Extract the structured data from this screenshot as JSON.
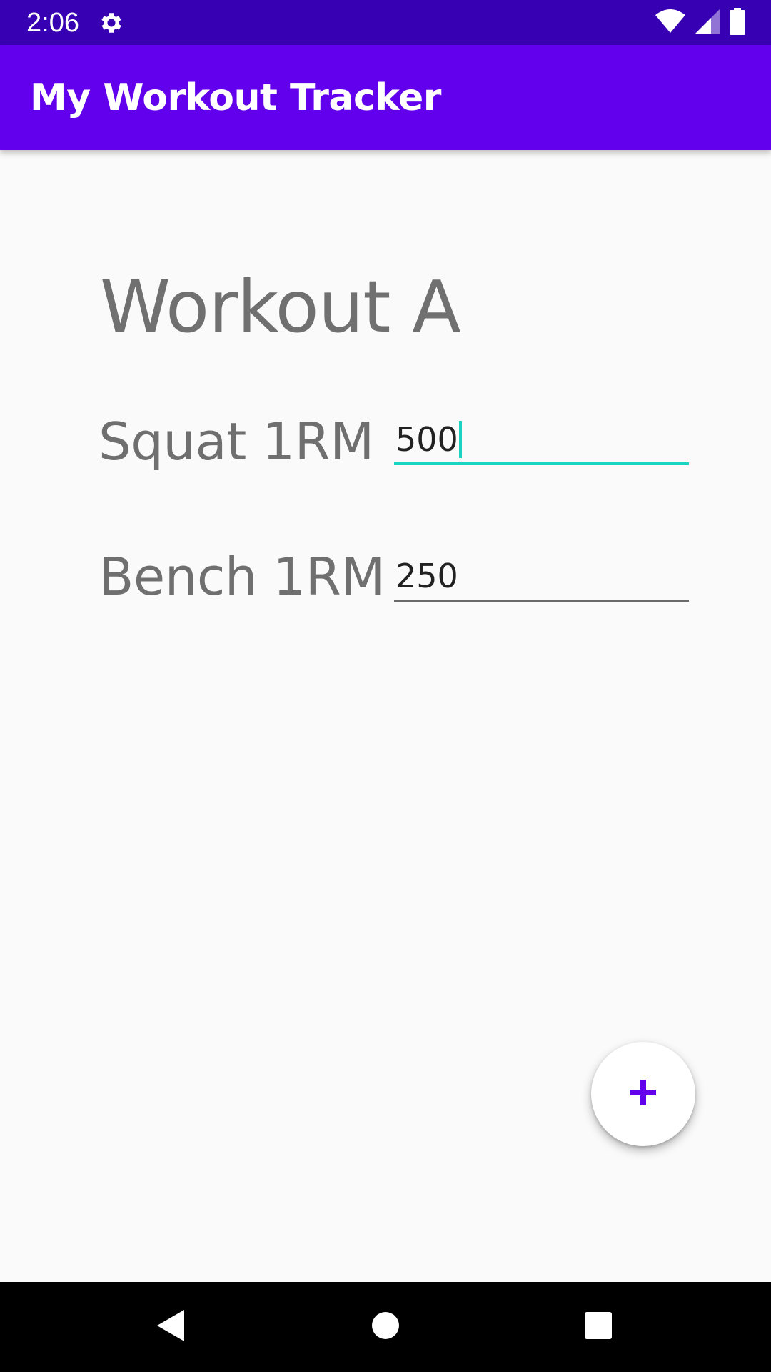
{
  "status_bar": {
    "time": "2:06",
    "icons": [
      "gear-icon",
      "wifi-icon",
      "signal-icon",
      "battery-icon"
    ]
  },
  "app_bar": {
    "title": "My Workout Tracker"
  },
  "content": {
    "workout_title": "Workout A",
    "rows": [
      {
        "label": "Squat 1RM",
        "value": "500"
      },
      {
        "label": "Bench 1RM",
        "value": "250"
      }
    ]
  },
  "fab": {
    "icon": "plus-icon"
  },
  "nav_bar": {
    "buttons": [
      "back-icon",
      "home-icon",
      "recents-icon"
    ]
  },
  "colors": {
    "status_bar": "#3700b3",
    "primary": "#6200ee",
    "accent": "#1ad3c3",
    "background": "#fafafa",
    "fab_icon": "#6200ee"
  }
}
